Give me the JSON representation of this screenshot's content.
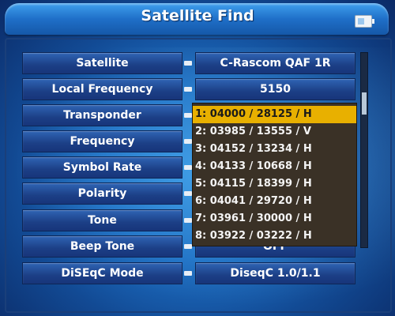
{
  "header": {
    "title": "Satellite Find",
    "battery_icon": "battery-icon"
  },
  "rows": [
    {
      "label": "Satellite",
      "value": "C-Rascom QAF 1R"
    },
    {
      "label": "Local Frequency",
      "value": "5150"
    },
    {
      "label": "Transponder",
      "value": "1: 04000 / 28125 / H"
    },
    {
      "label": "Frequency",
      "value": ""
    },
    {
      "label": "Symbol Rate",
      "value": ""
    },
    {
      "label": "Polarity",
      "value": ""
    },
    {
      "label": "Tone",
      "value": ""
    },
    {
      "label": "Beep Tone",
      "value": "OFF"
    },
    {
      "label": "DiSEqC Mode",
      "value": "DiseqC 1.0/1.1"
    }
  ],
  "transponder_list": {
    "selected_index": 0,
    "items": [
      "1: 04000 / 28125 / H",
      "2: 03985 / 13555 / V",
      "3: 04152 / 13234 / H",
      "4: 04133 / 10668 / H",
      "5: 04115 / 18399 / H",
      "6: 04041 / 29720 / H",
      "7: 03961 / 30000 / H",
      "8: 03922 / 03222 / H"
    ]
  },
  "colors": {
    "highlight": "#e8b000",
    "dropdown_bg": "#3a3126",
    "label_bg": "#1c3f86"
  }
}
